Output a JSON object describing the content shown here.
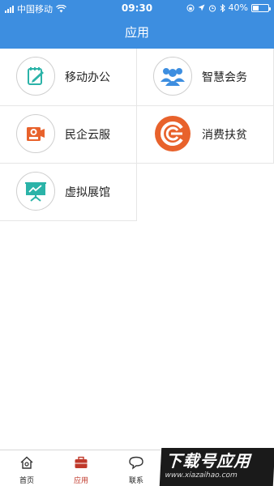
{
  "status_bar": {
    "carrier": "中国移动",
    "time": "09:30",
    "battery_percent": "40%",
    "battery_level": 0.4
  },
  "header": {
    "title": "应用"
  },
  "apps": [
    {
      "label": "移动办公",
      "icon": "notepad-pencil-icon",
      "color": "#2bb3a8"
    },
    {
      "label": "智慧会务",
      "icon": "people-group-icon",
      "color": "#3d8ee0"
    },
    {
      "label": "民企云服",
      "icon": "camera-kiosk-icon",
      "color": "#e8622c"
    },
    {
      "label": "消费扶贫",
      "icon": "spiral-logo-icon",
      "color": "#e8622c"
    },
    {
      "label": "虚拟展馆",
      "icon": "presentation-board-icon",
      "color": "#2bb3a8"
    }
  ],
  "tabbar": {
    "items": [
      {
        "label": "首页",
        "icon": "home-icon"
      },
      {
        "label": "应用",
        "icon": "briefcase-icon",
        "active": true,
        "color": "#c0392b"
      },
      {
        "label": "联系",
        "icon": "chat-bubble-icon"
      }
    ]
  },
  "watermark": {
    "title": "下载号应用",
    "url": "www.xiazaihao.com"
  }
}
